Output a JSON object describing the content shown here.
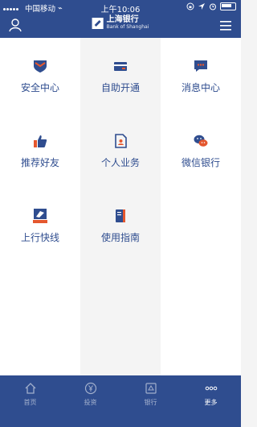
{
  "status_bar": {
    "carrier": "中国移动",
    "network": "⌁",
    "time": "上午10:06"
  },
  "header": {
    "brand_cn": "上海银行",
    "brand_en": "Bank of Shanghai"
  },
  "grid": {
    "items": [
      {
        "label": "安全中心",
        "icon": "shield-icon"
      },
      {
        "label": "自助开通",
        "icon": "card-icon"
      },
      {
        "label": "消息中心",
        "icon": "message-icon"
      },
      {
        "label": "推荐好友",
        "icon": "thumb-up-icon"
      },
      {
        "label": "个人业务",
        "icon": "document-user-icon"
      },
      {
        "label": "微信银行",
        "icon": "wechat-icon"
      },
      {
        "label": "上行快线",
        "icon": "express-logo-icon"
      },
      {
        "label": "使用指南",
        "icon": "guide-book-icon"
      }
    ]
  },
  "tabbar": {
    "tabs": [
      {
        "label": "首页",
        "icon": "home-icon",
        "active": false
      },
      {
        "label": "投资",
        "icon": "yen-coin-icon",
        "active": false
      },
      {
        "label": "银行",
        "icon": "bank-icon",
        "active": false
      },
      {
        "label": "更多",
        "icon": "more-dots-icon",
        "active": true
      }
    ]
  },
  "colors": {
    "primary": "#2f4d8f",
    "accent_red": "#e4572e",
    "tile_alt": "#f4f4f4"
  }
}
